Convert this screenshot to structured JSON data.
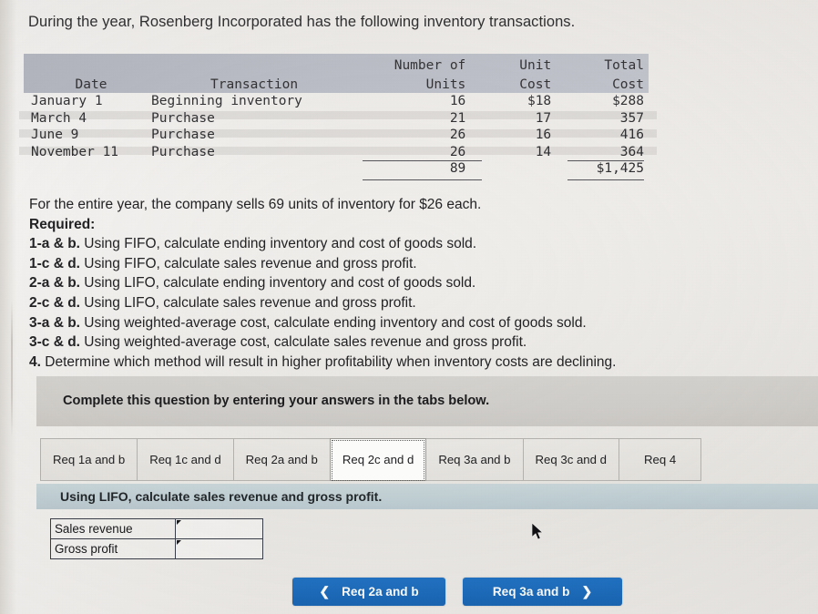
{
  "intro": "During the year, Rosenberg Incorporated has the following inventory transactions.",
  "inventory_table": {
    "headers": {
      "date": "Date",
      "transaction": "Transaction",
      "number_of_units_line1": "Number of",
      "number_of_units_line2": "Units",
      "unit_cost_line1": "Unit",
      "unit_cost_line2": "Cost",
      "total_cost_line1": "Total",
      "total_cost_line2": "Cost"
    },
    "rows": [
      {
        "date": "January 1",
        "transaction": "Beginning inventory",
        "units": "16",
        "unit_cost": "$18",
        "total_cost": "$288"
      },
      {
        "date": "March 4",
        "transaction": "Purchase",
        "units": "21",
        "unit_cost": "17",
        "total_cost": "357"
      },
      {
        "date": "June 9",
        "transaction": "Purchase",
        "units": "26",
        "unit_cost": "16",
        "total_cost": "416"
      },
      {
        "date": "November 11",
        "transaction": "Purchase",
        "units": "26",
        "unit_cost": "14",
        "total_cost": "364"
      }
    ],
    "totals": {
      "units": "89",
      "unit_cost": "",
      "total_cost": "$1,425"
    }
  },
  "sales_note": "For the entire year, the company sells 69 units of inventory for $26 each.",
  "required_heading": "Required:",
  "requirements": [
    {
      "label": "1-a & b.",
      "text": "Using FIFO, calculate ending inventory and cost of goods sold."
    },
    {
      "label": "1-c & d.",
      "text": "Using FIFO, calculate sales revenue and gross profit."
    },
    {
      "label": "2-a & b.",
      "text": "Using LIFO, calculate ending inventory and cost of goods sold."
    },
    {
      "label": "2-c & d.",
      "text": "Using LIFO, calculate sales revenue and gross profit."
    },
    {
      "label": "3-a & b.",
      "text": "Using weighted-average cost, calculate ending inventory and cost of goods sold."
    },
    {
      "label": "3-c & d.",
      "text": "Using weighted-average cost, calculate sales revenue and gross profit."
    },
    {
      "label": "4.",
      "text": "Determine which method will result in higher profitability when inventory costs are declining."
    }
  ],
  "complete_banner": "Complete this question by entering your answers in the tabs below.",
  "tabs": [
    {
      "label": "Req 1a and b",
      "active": false
    },
    {
      "label": "Req 1c and d",
      "active": false
    },
    {
      "label": "Req 2a and b",
      "active": false
    },
    {
      "label": "Req 2c and d",
      "active": true
    },
    {
      "label": "Req 3a and b",
      "active": false
    },
    {
      "label": "Req 3c and d",
      "active": false
    },
    {
      "label": "Req 4",
      "active": false
    }
  ],
  "tab_instruction": "Using LIFO, calculate sales revenue and gross profit.",
  "answer_table": {
    "rows": [
      {
        "label": "Sales revenue",
        "value": ""
      },
      {
        "label": "Gross profit",
        "value": ""
      }
    ]
  },
  "nav": {
    "prev_label": "Req 2a and b",
    "prev_icon": "chevron-left-icon",
    "next_label": "Req 3a and b",
    "next_icon": "chevron-right-icon",
    "button_color": "#1c6cbd"
  },
  "colors": {
    "page_background": "#efedea",
    "table_header_band": "#bcbfc9",
    "complete_band": "#d2d0cc",
    "instruction_strip": "#c3d2d7",
    "tab_inactive": "#eceae6",
    "tab_active": "#fbfbfa",
    "accent_blue": "#1c6cbd"
  }
}
